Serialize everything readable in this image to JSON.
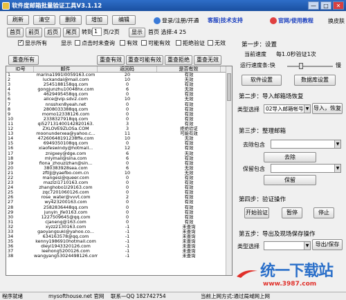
{
  "app": {
    "title": "软件度邮箱批量验证工具V3.1.12",
    "win_min": "—",
    "win_max": "□",
    "win_close": "✕"
  },
  "toolbar": {
    "refresh": "刷新",
    "clear": "清空",
    "delete": "删除",
    "add": "增加",
    "edit": "编辑",
    "login": "登录/注册/开通",
    "support": "客服|技术支持",
    "website": "官网/使用教程",
    "skin": "换皮肤"
  },
  "pager": {
    "first": "首页",
    "prev": "前页",
    "next": "后页",
    "last": "尾页",
    "goto": "转到",
    "page_value": "1",
    "page_total": "页/2页",
    "show": "显示",
    "summary": "首页 选择:4 25"
  },
  "filters": {
    "show_all": "显示所有",
    "show": "显示",
    "unchecked": "点击时未查询",
    "valid": "有效",
    "maybe_valid": "可能有效",
    "reject": "拒绝验证",
    "invalid": "无效"
  },
  "actions": {
    "recheck_all": "重查所有",
    "recheck_valid": "重查有效",
    "recheck_maybe": "重查可能有效",
    "recheck_reject": "重查拒绝",
    "recheck_invalid": "重查无效"
  },
  "table": {
    "headers": [
      "ID号",
      "邮件",
      "返回码",
      "是否有效"
    ],
    "rows": [
      [
        "1",
        "marina1991l0059163.com",
        "20",
        "有效"
      ],
      [
        "2",
        "luckandai@mail.com",
        "10",
        "无效"
      ],
      [
        "3",
        "2545188158qq.com",
        "0",
        "有效"
      ],
      [
        "4",
        "gongjunzhu10048hx.com",
        "6",
        "无效"
      ],
      [
        "5",
        "4629495458qq.com",
        "0",
        "有效"
      ],
      [
        "6",
        "alice@vip.sdv2.com",
        "10",
        "无效"
      ],
      [
        "7",
        "nnsshxn8yeah.net",
        "0",
        "有效"
      ],
      [
        "8",
        "2808033388qq.com",
        "0",
        "有效"
      ],
      [
        "9",
        "momo12338126.com",
        "0",
        "有效"
      ],
      [
        "10",
        "2338327918qq.com",
        "0",
        "有效"
      ],
      [
        "11",
        "qi527131400142820163.",
        "3",
        "有效"
      ],
      [
        "12",
        "ZXLOVE9ZLOSa.COM",
        "3",
        "拒绝验证"
      ],
      [
        "13",
        "moonunderxea@yahoo.c...",
        "11",
        "可能有效"
      ],
      [
        "14",
        "47260648191238ffe.com",
        "10",
        "无效"
      ],
      [
        "15",
        "6949350108qq.com",
        "0",
        "有效"
      ],
      [
        "16",
        "xiaofeswindy@hotmail...",
        "12",
        "有效"
      ],
      [
        "17",
        "znigxey@dge.com",
        "6",
        "无效"
      ],
      [
        "18",
        "mlymail@sina.com",
        "6",
        "有效"
      ],
      [
        "19",
        "fiona_zhouzizhan@sin...",
        "0",
        "有效"
      ],
      [
        "20",
        "380383928sea.com",
        "6",
        "无效"
      ],
      [
        "21",
        "zftljj@yaefbo.com.cn",
        "10",
        "无效"
      ],
      [
        "22",
        "mangesi@queer.com",
        "0",
        "有效"
      ],
      [
        "23",
        "mazizi1710163.com",
        "0",
        "有效"
      ],
      [
        "24",
        "zhanghobo1l29163.com",
        "0",
        "有效"
      ],
      [
        "25",
        "zqc7201060126.com",
        "0",
        "有效"
      ],
      [
        "26",
        "rose_water@vvvt.com",
        "2",
        "有效"
      ],
      [
        "27",
        "wy423200163.com",
        "0",
        "有效"
      ],
      [
        "28",
        "2582836448qq.com",
        "0",
        "有效"
      ],
      [
        "29",
        "junyin_jfe0163.com",
        "0",
        "有效"
      ],
      [
        "30",
        "1227509645@qq.com",
        "0",
        "有效"
      ],
      [
        "31",
        "cjaneng@163.com",
        "0",
        "有效"
      ],
      [
        "32",
        "xyzz2130163.com",
        "-1",
        "未查询"
      ],
      [
        "33",
        "gaoyangsuki@yahoo.co...",
        "-1",
        "未查询"
      ],
      [
        "34",
        "634163578@qq.com",
        "-1",
        "未查询"
      ],
      [
        "35",
        "kenny1986910hotmail.com",
        "-1",
        "未查询"
      ],
      [
        "36",
        "dieyi1943320126.com",
        "-1",
        "未查询"
      ],
      [
        "37",
        "leehong5200126.com",
        "-1",
        "未查询"
      ],
      [
        "38",
        "wangyang53024498126.com",
        "-1",
        "未查询"
      ]
    ]
  },
  "right": {
    "step1": "第一步：设置",
    "speed_label": "当前速度",
    "speed_value": "每1.0秒验证1次",
    "speed_text": "运行速度条:快",
    "slow": "慢",
    "speed_level": 0.3,
    "btn_software": "软件设置",
    "btn_db": "数据库设置",
    "step2": "第二步：导入邮箱场恢复",
    "type_label": "类型选择",
    "type_value": "02导入邮箱帐号",
    "btn_import": "导入，恢复",
    "step3": "第三步：整理邮箱",
    "dedup_label": "去除包含",
    "btn_dedup": "去除",
    "keep_label": "保留包含",
    "btn_keep": "保留",
    "step4": "第四步：验证操作",
    "btn_start": "开始验证",
    "btn_pause": "暂停",
    "btn_stop": "停止",
    "step5": "第五步：导出及现场保存操作",
    "type_label2": "类型选择",
    "btn_export": "导出/保存"
  },
  "watermark": {
    "logo": "统一下载站",
    "url": "www.3987.com"
  },
  "status": {
    "ready": "程序就绪",
    "site": "mysofthouse.net 官网",
    "contact": "联系—QQ 182742754",
    "network": "当前上网方式:通过局域网上网"
  }
}
